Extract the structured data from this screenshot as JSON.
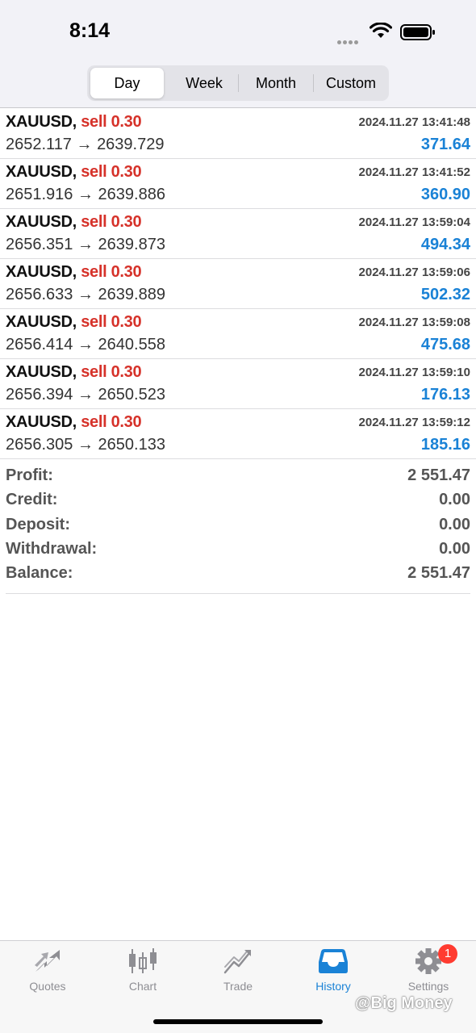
{
  "status_bar": {
    "time": "8:14"
  },
  "period_tabs": [
    {
      "label": "Day",
      "active": true
    },
    {
      "label": "Week",
      "active": false
    },
    {
      "label": "Month",
      "active": false
    },
    {
      "label": "Custom",
      "active": false
    }
  ],
  "trades": [
    {
      "symbol": "XAUUSD,",
      "side": "sell 0.30",
      "time": "2024.11.27 13:41:48",
      "open": "2652.117",
      "arrow": "→",
      "close": "2639.729",
      "profit": "371.64"
    },
    {
      "symbol": "XAUUSD,",
      "side": "sell 0.30",
      "time": "2024.11.27 13:41:52",
      "open": "2651.916",
      "arrow": "→",
      "close": "2639.886",
      "profit": "360.90"
    },
    {
      "symbol": "XAUUSD,",
      "side": "sell 0.30",
      "time": "2024.11.27 13:59:04",
      "open": "2656.351",
      "arrow": "→",
      "close": "2639.873",
      "profit": "494.34"
    },
    {
      "symbol": "XAUUSD,",
      "side": "sell 0.30",
      "time": "2024.11.27 13:59:06",
      "open": "2656.633",
      "arrow": "→",
      "close": "2639.889",
      "profit": "502.32"
    },
    {
      "symbol": "XAUUSD,",
      "side": "sell 0.30",
      "time": "2024.11.27 13:59:08",
      "open": "2656.414",
      "arrow": "→",
      "close": "2640.558",
      "profit": "475.68"
    },
    {
      "symbol": "XAUUSD,",
      "side": "sell 0.30",
      "time": "2024.11.27 13:59:10",
      "open": "2656.394",
      "arrow": "→",
      "close": "2650.523",
      "profit": "176.13"
    },
    {
      "symbol": "XAUUSD,",
      "side": "sell 0.30",
      "time": "2024.11.27 13:59:12",
      "open": "2656.305",
      "arrow": "→",
      "close": "2650.133",
      "profit": "185.16"
    }
  ],
  "summary": [
    {
      "label": "Profit:",
      "value": "2 551.47"
    },
    {
      "label": "Credit:",
      "value": "0.00"
    },
    {
      "label": "Deposit:",
      "value": "0.00"
    },
    {
      "label": "Withdrawal:",
      "value": "0.00"
    },
    {
      "label": "Balance:",
      "value": "2 551.47"
    }
  ],
  "colors": {
    "accent": "#1a82d6",
    "sell": "#d6322a",
    "badge": "#ff3b30"
  },
  "tabbar": {
    "items": [
      {
        "label": "Quotes",
        "icon": "quotes-arrows-icon"
      },
      {
        "label": "Chart",
        "icon": "candlestick-chart-icon"
      },
      {
        "label": "Trade",
        "icon": "trade-trend-icon"
      },
      {
        "label": "History",
        "icon": "inbox-tray-icon",
        "active": true
      },
      {
        "label": "Settings",
        "icon": "gear-icon",
        "badge": "1"
      }
    ]
  },
  "watermark": "@Big Money"
}
